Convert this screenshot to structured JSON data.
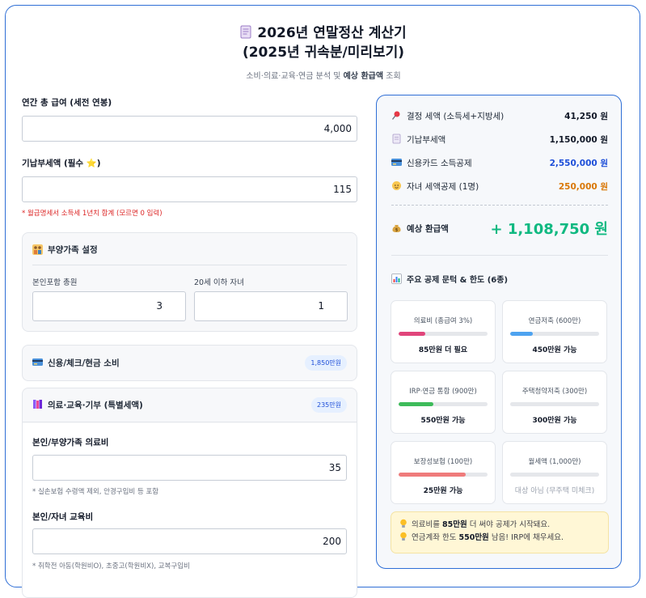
{
  "header": {
    "title_line1": "2026년 연말정산 계산기",
    "title_line2": "(2025년 귀속분/미리보기)",
    "subtitle_pre": "소비·의료·교육·연금 분석 및 ",
    "subtitle_bold": "예상 환급액",
    "subtitle_post": " 조회"
  },
  "form": {
    "salary_label": "연간 총 급여 (세전 연봉)",
    "salary_value": "4,000",
    "prepaid_label": "기납부세액 (필수 ⭐)",
    "prepaid_value": "115",
    "prepaid_hint": "* 월급명세서 소득세 1년치 합계 (모르면 0 입력)",
    "dependents": {
      "title": "부양가족 설정",
      "total_label": "본인포함 총원",
      "total_value": "3",
      "children_label": "20세 이하 자녀",
      "children_value": "1"
    },
    "card_section": {
      "title": "신용/체크/현금 소비",
      "badge": "1,850만원"
    },
    "special_section": {
      "title": "의료·교육·기부 (특별세액)",
      "badge": "235만원",
      "medical_label": "본인/부양가족 의료비",
      "medical_value": "35",
      "medical_hint": "* 실손보험 수령액 제외, 안경구입비 등 포함",
      "education_label": "본인/자녀 교육비",
      "education_value": "200",
      "education_hint": "* 취학전 아동(학원비O), 초중고(학원비X), 교복구입비"
    }
  },
  "summary": {
    "rows": [
      {
        "label": "결정 세액 (소득세+지방세)",
        "value": "41,250 원"
      },
      {
        "label": "기납부세액",
        "value": "1,150,000 원"
      },
      {
        "label": "신용카드 소득공제",
        "value": "2,550,000 원"
      },
      {
        "label": "자녀 세액공제 (1명)",
        "value": "250,000 원"
      }
    ],
    "refund_label": "예상 환급액",
    "refund_value": "+ 1,108,750 원",
    "benefits_title": "주요 공제 문턱 & 한도 (6종)",
    "benefits": [
      {
        "title": "의료비 (총급여 3%)",
        "status": "85만원 더 필요",
        "fill": 0.3,
        "color": "#e0457b"
      },
      {
        "title": "연금저축 (600만)",
        "status": "450만원 가능",
        "fill": 0.25,
        "color": "#4ea3f0"
      },
      {
        "title": "IRP·연금 통합 (900만)",
        "status": "550만원 가능",
        "fill": 0.39,
        "color": "#3dbb5a"
      },
      {
        "title": "주택청약저축 (300만)",
        "status": "300만원 가능",
        "fill": 0,
        "color": "#9ca3af"
      },
      {
        "title": "보장성보험 (100만)",
        "status": "25만원 가능",
        "fill": 0.75,
        "color": "#ef7b7b"
      },
      {
        "title": "월세액 (1,000만)",
        "status": "대상 아님 (무주택 미체크)",
        "fill": 0,
        "color": "#9ca3af"
      }
    ],
    "tip1_pre": "의료비를 ",
    "tip1_bold": "85만원",
    "tip1_post": " 더 써야 공제가 시작돼요.",
    "tip2_pre": "연금계좌 한도 ",
    "tip2_bold": "550만원",
    "tip2_post": " 남음! IRP에 채우세요."
  }
}
